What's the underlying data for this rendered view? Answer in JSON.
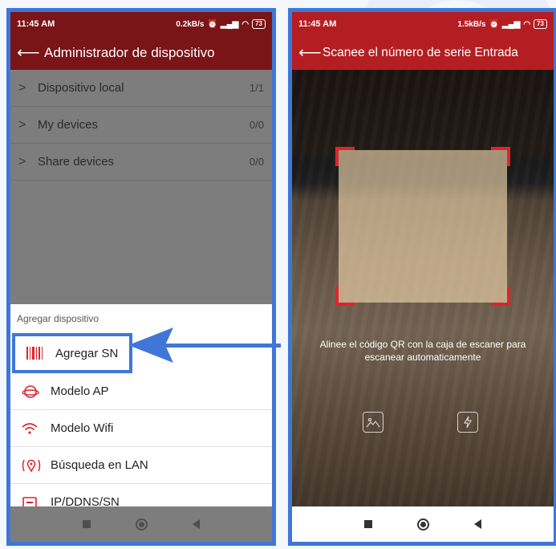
{
  "left": {
    "status": {
      "time": "11:45 AM",
      "speed": "0.2kB/s",
      "battery": "73"
    },
    "appbar": {
      "title": "Administrador de dispositivo"
    },
    "devices": [
      {
        "label": "Dispositivo local",
        "count": "1/1"
      },
      {
        "label": "My devices",
        "count": "0/0"
      },
      {
        "label": "Share devices",
        "count": "0/0"
      }
    ],
    "sheet": {
      "header": "Agregar dispositivo",
      "items": [
        {
          "label": "Agregar SN",
          "icon": "barcode-icon"
        },
        {
          "label": "Modelo AP",
          "icon": "ap-ring-icon"
        },
        {
          "label": "Modelo Wifi",
          "icon": "wifi-icon"
        },
        {
          "label": "Búsqueda en LAN",
          "icon": "location-pin-icon"
        },
        {
          "label": "IP/DDNS/SN",
          "icon": "ip-icon"
        }
      ]
    }
  },
  "right": {
    "status": {
      "time": "11:45 AM",
      "speed": "1.5kB/s",
      "battery": "73"
    },
    "appbar": {
      "title": "Scanee el número de serie Entrada"
    },
    "hint": "Alinee el código QR con la caja de escaner para escanear automaticamente"
  },
  "colors": {
    "brand": "#b41e22",
    "highlight": "#3f77d8",
    "accent": "#e0232a"
  }
}
